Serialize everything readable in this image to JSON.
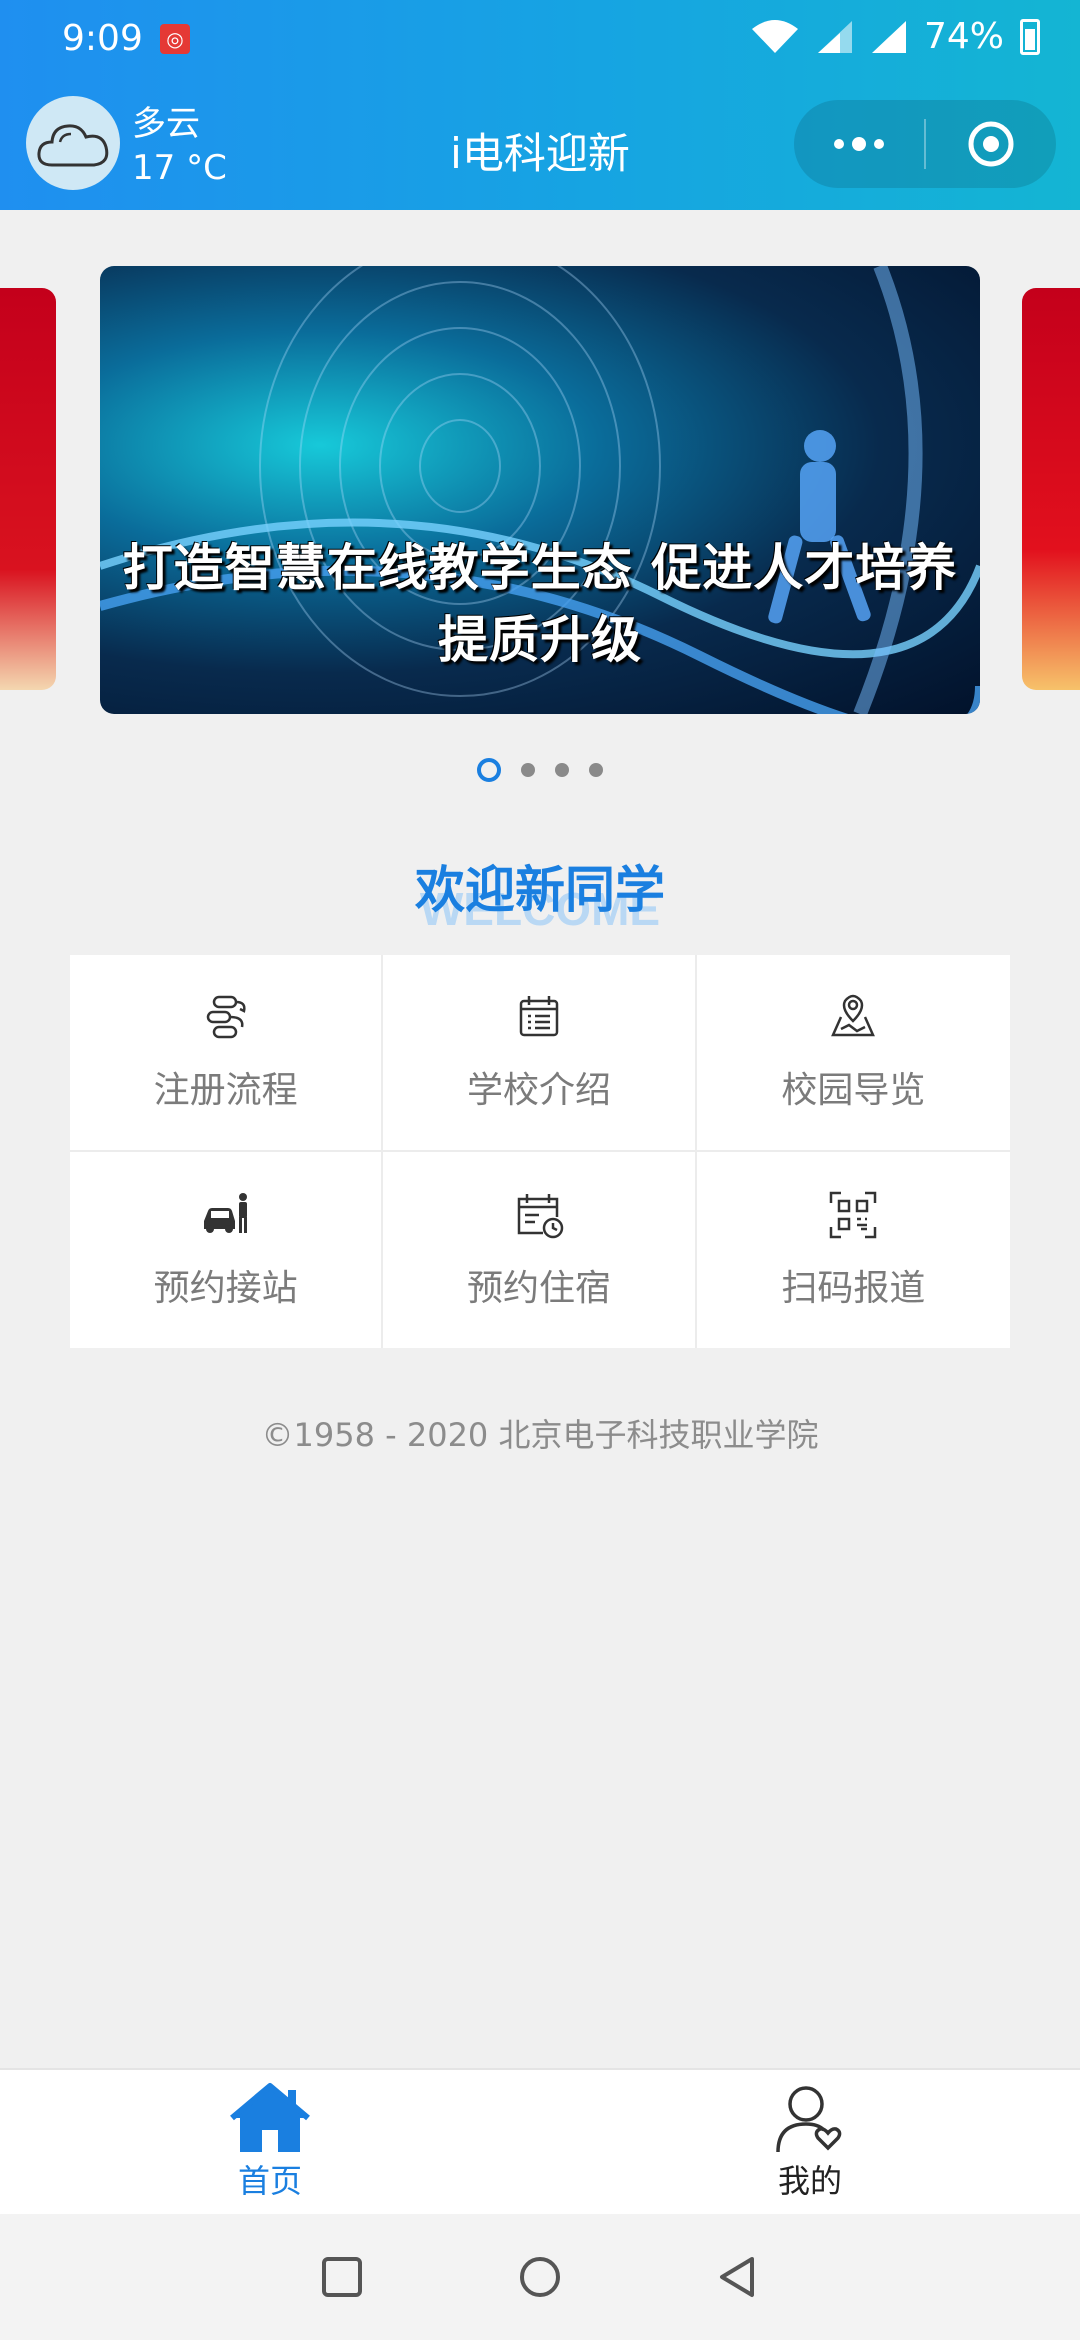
{
  "status_bar": {
    "time": "9:09",
    "battery": "74%"
  },
  "header": {
    "weather": {
      "condition": "多云",
      "temperature": "17 °C"
    },
    "title": "i电科迎新"
  },
  "banner": {
    "text": "打造智慧在线教学生态  促进人才培养提质升级",
    "slide_count": 4,
    "active_index": 0
  },
  "welcome": {
    "title": "欢迎新同学",
    "subtitle": "WELCOME"
  },
  "menu": {
    "items": [
      {
        "label": "注册流程",
        "icon": "process-flow-icon"
      },
      {
        "label": "学校介绍",
        "icon": "calendar-list-icon"
      },
      {
        "label": "校园导览",
        "icon": "map-pin-icon"
      },
      {
        "label": "预约接站",
        "icon": "car-person-icon"
      },
      {
        "label": "预约住宿",
        "icon": "calendar-clock-icon"
      },
      {
        "label": "扫码报道",
        "icon": "qr-scan-icon"
      }
    ]
  },
  "footer": {
    "copyright": "©1958 - 2020 北京电子科技职业学院"
  },
  "tabbar": {
    "tabs": [
      {
        "label": "首页",
        "icon": "home-icon",
        "active": true
      },
      {
        "label": "我的",
        "icon": "user-heart-icon",
        "active": false
      }
    ]
  },
  "colors": {
    "primary": "#1a7fe0",
    "header_gradient_start": "#1f8ff0",
    "header_gradient_end": "#14b5d3",
    "background": "#f0f0f0"
  }
}
